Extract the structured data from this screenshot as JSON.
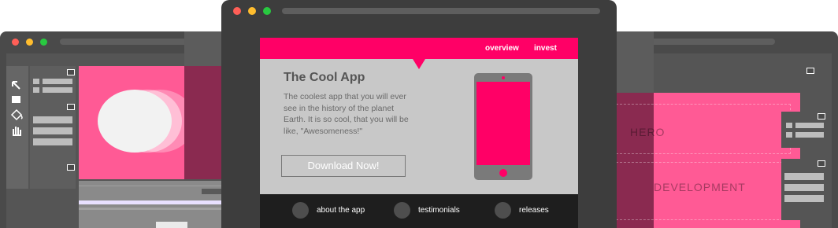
{
  "front_window": {
    "nav": {
      "overview": "overview",
      "invest": "invest"
    },
    "hero": {
      "title": "The Cool App",
      "description": "The coolest app that you will ever see in the history of the planet Earth.  It is so cool, that you will be like, \"Awesomeness!\"",
      "download_label": "Download Now!"
    },
    "footer": {
      "items": [
        "about the app",
        "testimonials",
        "releases"
      ]
    }
  },
  "back_window": {
    "wireframe_labels": [
      "HERO",
      "DEVELOPMENT"
    ]
  },
  "colors": {
    "accent": "#ff0066",
    "accent_soft": "#ff5a95",
    "frame": "#3d3d3d"
  },
  "icons": {
    "tools": [
      "pointer-arrow-icon",
      "rectangle-icon",
      "paint-bucket-icon",
      "hand-icon"
    ]
  }
}
